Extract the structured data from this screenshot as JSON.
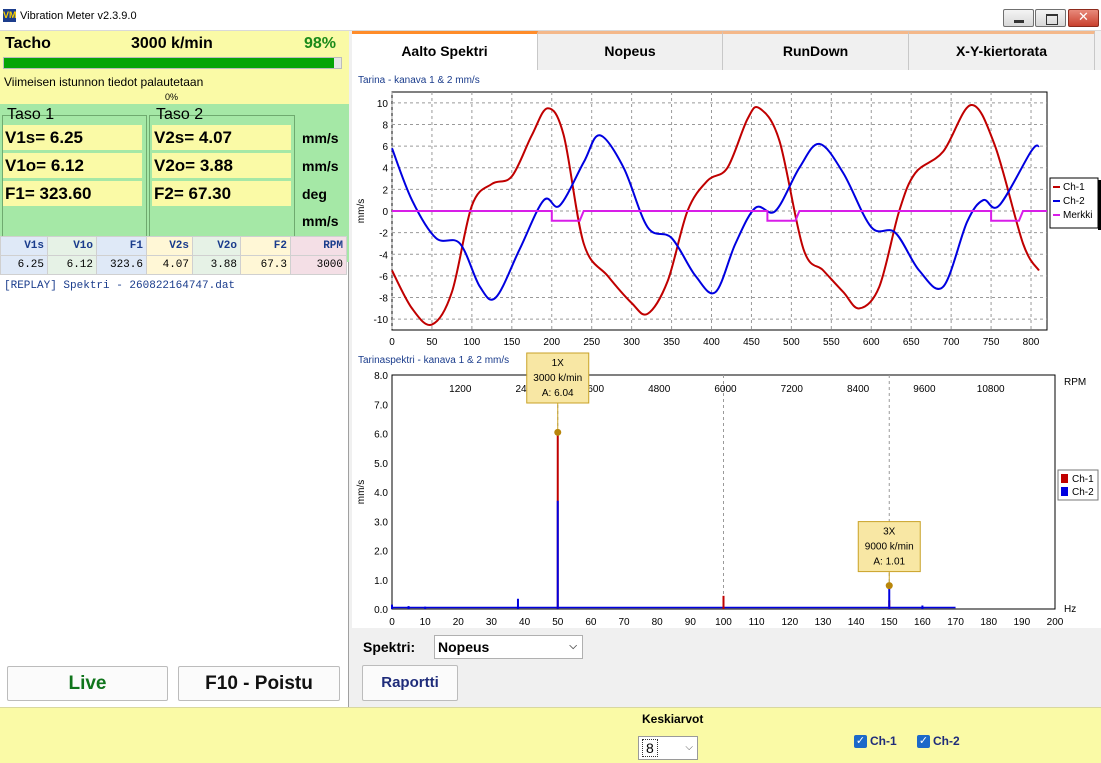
{
  "window": {
    "title": "Vibration Meter v2.3.9.0",
    "icon_text": "VM",
    "controls": {
      "close_glyph": "✕"
    }
  },
  "tacho": {
    "label": "Tacho",
    "rpm": "3000 k/min",
    "percent": "98%",
    "progress": 0.98,
    "status": "Viimeisen istunnon tiedot palautetaan",
    "status_percent": "0%"
  },
  "levels": {
    "taso1": {
      "title": "Taso 1",
      "v1s": "V1s= 6.25",
      "v1o": "V1o= 6.12",
      "f1": "F1= 323.60"
    },
    "taso2": {
      "title": "Taso 2",
      "v2s": "V2s= 4.07",
      "v2o": "V2o= 3.88",
      "f2": "F2= 67.30"
    },
    "units": [
      "mm/s",
      "mm/s",
      "deg",
      "mm/s"
    ]
  },
  "summary_table": {
    "headers": [
      "V1s",
      "V1o",
      "F1",
      "V2s",
      "V2o",
      "F2",
      "RPM"
    ],
    "row": [
      "6.25",
      "6.12",
      "323.6",
      "4.07",
      "3.88",
      "67.3",
      "3000"
    ]
  },
  "replay_line": "[REPLAY] Spektri - 260822164747.dat",
  "buttons": {
    "live": "Live",
    "exit": "F10 - Poistu",
    "raportti": "Raportti"
  },
  "tabs": [
    "Aalto Spektri",
    "Nopeus",
    "RunDown",
    "X-Y-kiertorata"
  ],
  "active_tab": 0,
  "spektri": {
    "label": "Spektri:",
    "selected": "Nopeus"
  },
  "bottom": {
    "keskiarvot_label": "Keskiarvot",
    "avg_value": "8",
    "ch1": {
      "label": "Ch-1",
      "checked": true
    },
    "ch2": {
      "label": "Ch-2",
      "checked": true
    }
  },
  "colors": {
    "ch1": "#c00000",
    "ch2": "#0000e0",
    "marker": "#d81ee8",
    "marker_flag": "#b8860b"
  },
  "chart_data": [
    {
      "type": "line",
      "caption": "Tarina  - kanava 1 & 2 mm/s",
      "ylabel": "mm/s",
      "xlim": [
        0,
        820
      ],
      "ylim": [
        -11,
        11
      ],
      "xticks": [
        0,
        50,
        100,
        150,
        200,
        250,
        300,
        350,
        400,
        450,
        500,
        550,
        600,
        650,
        700,
        750,
        800
      ],
      "yticks": [
        10,
        8,
        6,
        4,
        2,
        0,
        -2,
        -4,
        -6,
        -8,
        -10
      ],
      "grid": true,
      "legend_position": "right",
      "legend": [
        "Ch-1",
        "Ch-2",
        "Merkki"
      ],
      "series": [
        {
          "name": "Ch-1",
          "x": [
            0,
            25,
            50,
            75,
            100,
            125,
            150,
            175,
            195,
            215,
            240,
            270,
            300,
            320,
            345,
            370,
            395,
            420,
            445,
            460,
            485,
            515,
            540,
            565,
            585,
            610,
            635,
            655,
            690,
            725,
            755,
            790,
            810
          ],
          "values": [
            -5.5,
            -9.0,
            -10.5,
            -7.5,
            0.5,
            2.5,
            3.2,
            7.0,
            9.5,
            7.0,
            -3.0,
            -6.0,
            -8.5,
            -9.5,
            -6.5,
            0.0,
            2.8,
            4.0,
            8.5,
            9.5,
            6.5,
            -3.5,
            -5.5,
            -7.5,
            -9.0,
            -7.0,
            0.0,
            3.5,
            5.5,
            9.8,
            6.0,
            -3.0,
            -5.5
          ]
        },
        {
          "name": "Ch-2",
          "x": [
            0,
            25,
            55,
            85,
            110,
            130,
            160,
            190,
            210,
            240,
            260,
            290,
            320,
            350,
            380,
            405,
            430,
            455,
            480,
            510,
            535,
            565,
            600,
            630,
            660,
            690,
            720,
            740,
            760,
            800,
            810
          ],
          "values": [
            5.8,
            1.0,
            -2.5,
            -3.0,
            -7.0,
            -8.0,
            -3.5,
            1.0,
            0.5,
            4.5,
            7.0,
            4.0,
            -1.5,
            -2.5,
            -6.0,
            -7.5,
            -3.0,
            0.3,
            0.0,
            4.0,
            6.2,
            3.5,
            -1.5,
            -2.0,
            -5.5,
            -7.0,
            -1.0,
            1.0,
            0.5,
            5.5,
            6.0
          ]
        },
        {
          "name": "Merkki",
          "x": [
            0,
            200,
            200,
            235,
            240,
            470,
            470,
            505,
            510,
            750,
            750,
            785,
            790,
            820
          ],
          "values": [
            0,
            0,
            -0.9,
            -0.9,
            0,
            0,
            -0.9,
            -0.9,
            0,
            0,
            -0.9,
            -0.9,
            0,
            0
          ]
        }
      ]
    },
    {
      "type": "bar",
      "caption": "Tarinaspektri  - kanava 1 & 2 mm/s",
      "ylabel": "mm/s",
      "xlabel": "Hz",
      "secondary_xlabel": "RPM",
      "xlim": [
        0,
        200
      ],
      "ylim": [
        0,
        8
      ],
      "xticks": [
        0,
        10,
        20,
        30,
        40,
        50,
        60,
        70,
        80,
        90,
        100,
        110,
        120,
        130,
        140,
        150,
        160,
        170,
        180,
        190,
        200
      ],
      "yticks": [
        8.0,
        7.0,
        6.0,
        5.0,
        4.0,
        3.0,
        2.0,
        1.0,
        0.0
      ],
      "rpm_ticks": [
        "1200",
        "2400",
        "3600",
        "4800",
        "6000",
        "7200",
        "8400",
        "9600",
        "10800"
      ],
      "rpm_tick_hz": [
        20,
        40,
        60,
        80,
        100,
        120,
        140,
        160,
        180
      ],
      "legend": [
        "Ch-1",
        "Ch-2"
      ],
      "legend_position": "right",
      "series": [
        {
          "name": "Ch-1",
          "x": [
            50,
            100,
            150
          ],
          "values": [
            6.04,
            0.45,
            0.3
          ]
        },
        {
          "name": "Ch-2",
          "x": [
            0,
            5,
            10,
            38,
            50,
            150,
            160
          ],
          "values": [
            0.15,
            0.1,
            0.08,
            0.35,
            3.7,
            0.8,
            0.12
          ]
        }
      ],
      "annotations": [
        {
          "label": "1X",
          "line2": "3000 k/min",
          "line3": "A: 6.04",
          "x": 50,
          "y": 6.04
        },
        {
          "label": "3X",
          "line2": "9000 k/min",
          "line3": "A: 1.01",
          "x": 150,
          "y": 0.8
        }
      ]
    }
  ]
}
